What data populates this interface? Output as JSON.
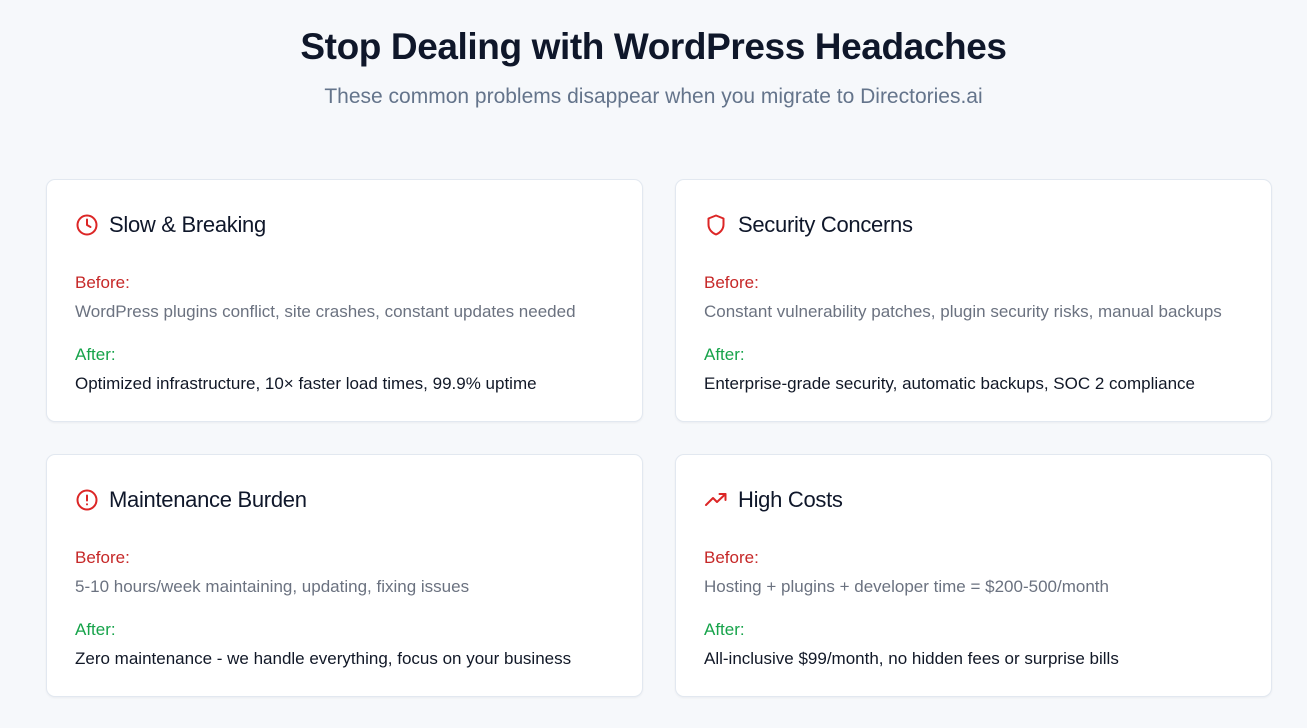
{
  "header": {
    "title": "Stop Dealing with WordPress Headaches",
    "subtitle": "These common problems disappear when you migrate to Directories.ai"
  },
  "colors": {
    "icon_red": "#dc2626",
    "before_red": "#c62828",
    "after_green": "#16a34a",
    "muted_text": "#6b7280"
  },
  "cards": [
    {
      "icon": "clock-icon",
      "title": "Slow & Breaking",
      "before_label": "Before:",
      "before_text": "WordPress plugins conflict, site crashes, constant updates needed",
      "after_label": "After:",
      "after_text": "Optimized infrastructure, 10× faster load times, 99.9% uptime"
    },
    {
      "icon": "shield-icon",
      "title": "Security Concerns",
      "before_label": "Before:",
      "before_text": "Constant vulnerability patches, plugin security risks, manual backups",
      "after_label": "After:",
      "after_text": "Enterprise-grade security, automatic backups, SOC 2 compliance"
    },
    {
      "icon": "alert-circle-icon",
      "title": "Maintenance Burden",
      "before_label": "Before:",
      "before_text": "5-10 hours/week maintaining, updating, fixing issues",
      "after_label": "After:",
      "after_text": "Zero maintenance - we handle everything, focus on your business"
    },
    {
      "icon": "trending-up-icon",
      "title": "High Costs",
      "before_label": "Before:",
      "before_text": "Hosting + plugins + developer time = $200-500/month",
      "after_label": "After:",
      "after_text": "All-inclusive $99/month, no hidden fees or surprise bills"
    }
  ]
}
